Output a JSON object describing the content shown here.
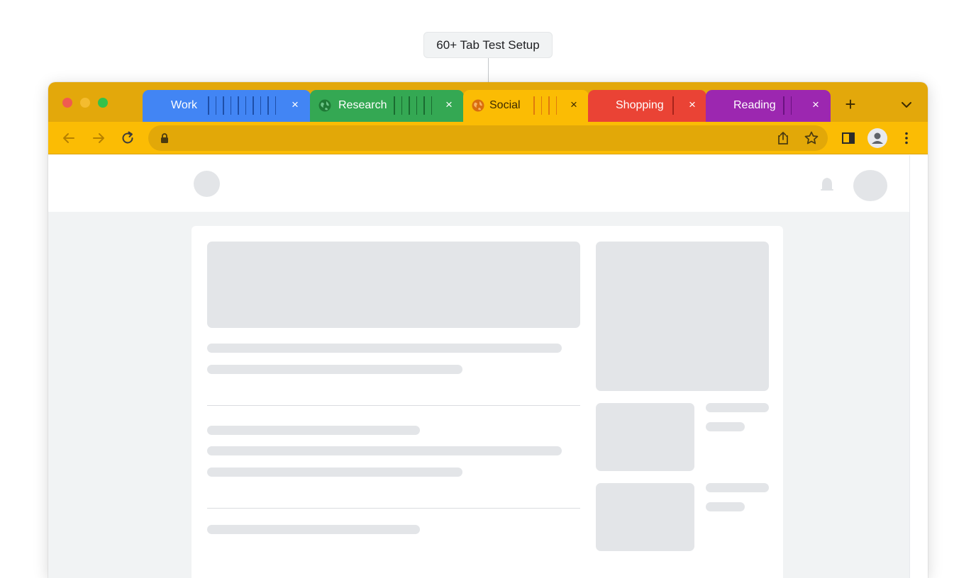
{
  "callout": {
    "text": "60+ Tab Test Setup"
  },
  "browser": {
    "tabs": [
      {
        "label": "Work",
        "color": "#4285f4",
        "close": "×"
      },
      {
        "label": "Research",
        "color": "#34a853",
        "close": "×"
      },
      {
        "label": "Social",
        "color": "#fbbc04",
        "close": "×"
      },
      {
        "label": "Shopping",
        "color": "#ea4335",
        "close": "×"
      },
      {
        "label": "Reading",
        "color": "#9c27b0",
        "close": "×"
      }
    ],
    "new_tab": "+",
    "toolbar_color": "#fbbc04",
    "tabbar_color": "#e3a80b",
    "icons": [
      "back-icon",
      "forward-icon",
      "reload-icon",
      "lock-icon",
      "share-icon",
      "star-icon",
      "side-panel-icon",
      "profile-icon",
      "more-icon"
    ]
  }
}
